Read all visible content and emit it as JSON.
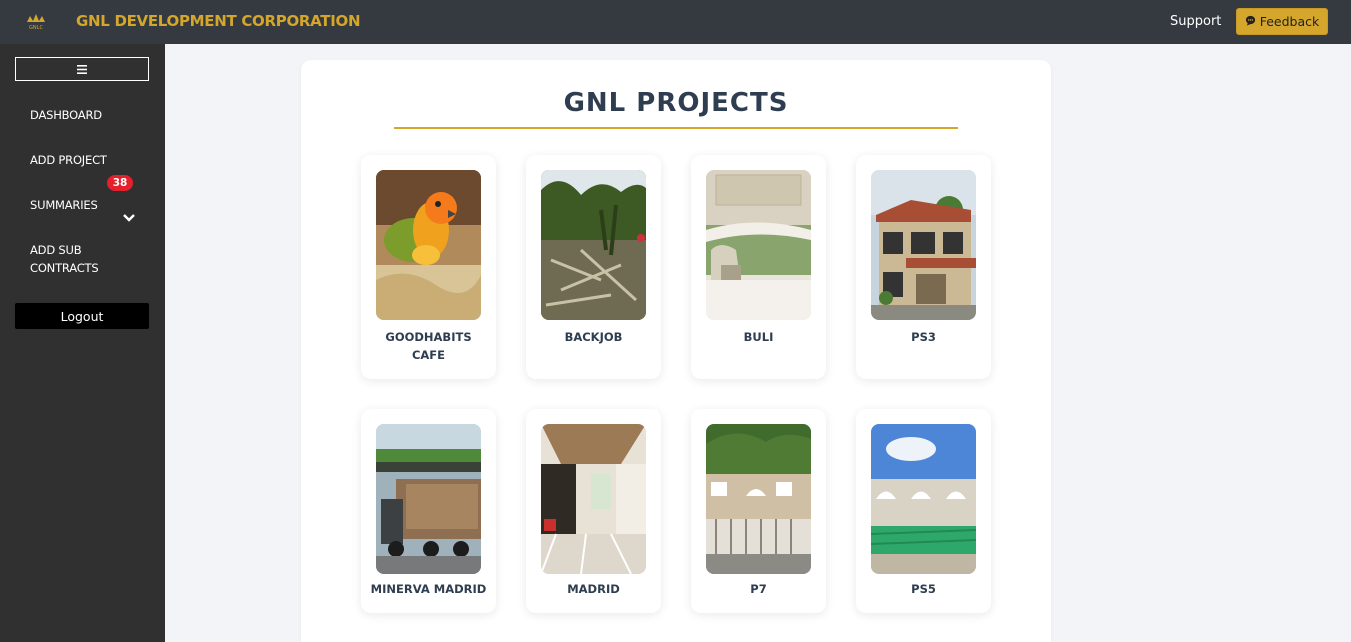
{
  "header": {
    "brand": "GNL DEVELOPMENT CORPORATION",
    "logo_text": "GNLC",
    "support_label": "Support",
    "feedback_label": "Feedback",
    "brand_color": "#d4a72c"
  },
  "sidebar": {
    "menu_icon": "hamburger-icon",
    "items": [
      {
        "label": "DASHBOARD"
      },
      {
        "label": "ADD PROJECT"
      },
      {
        "label": "SUMMARIES",
        "badge": "38"
      },
      {
        "label": "ADD SUB CONTRACTS"
      }
    ],
    "logout_label": "Logout"
  },
  "main": {
    "title": "GNL PROJECTS",
    "projects": [
      {
        "name": "GOODHABITS CAFE"
      },
      {
        "name": "BACKJOB"
      },
      {
        "name": "BULI"
      },
      {
        "name": "PS3"
      },
      {
        "name": "MINERVA MADRID"
      },
      {
        "name": "MADRID"
      },
      {
        "name": "P7"
      },
      {
        "name": "PS5"
      }
    ]
  }
}
